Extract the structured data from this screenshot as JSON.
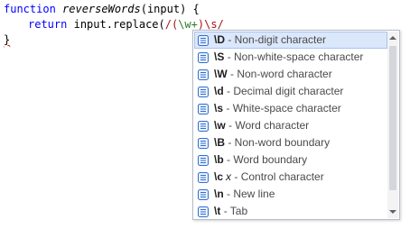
{
  "editor": {
    "line1": {
      "kw_function": "function",
      "name": "reverseWords",
      "params": "(input) {"
    },
    "line2": {
      "kw_return": "return",
      "call": "input.replace(",
      "regex_open": "/(",
      "regex_group": "\\w+",
      "regex_close": ")\\s/"
    },
    "line3": {
      "brace": "}"
    }
  },
  "completion": {
    "items": [
      {
        "token": "\\D",
        "arg": "",
        "description": "- Non-digit character",
        "icon": "snippet-icon",
        "selected": true
      },
      {
        "token": "\\S",
        "arg": "",
        "description": "- Non-white-space character",
        "icon": "snippet-icon",
        "selected": false
      },
      {
        "token": "\\W",
        "arg": "",
        "description": "- Non-word character",
        "icon": "snippet-icon",
        "selected": false
      },
      {
        "token": "\\d",
        "arg": "",
        "description": "- Decimal digit character",
        "icon": "snippet-icon",
        "selected": false
      },
      {
        "token": "\\s",
        "arg": "",
        "description": "- White-space character",
        "icon": "snippet-icon",
        "selected": false
      },
      {
        "token": "\\w",
        "arg": "",
        "description": "- Word character",
        "icon": "snippet-icon",
        "selected": false
      },
      {
        "token": "\\B",
        "arg": "",
        "description": "- Non-word boundary",
        "icon": "snippet-icon",
        "selected": false
      },
      {
        "token": "\\b",
        "arg": "",
        "description": "- Word boundary",
        "icon": "snippet-icon",
        "selected": false
      },
      {
        "token": "\\c",
        "arg": "x",
        "description": "- Control character",
        "icon": "snippet-icon",
        "selected": false
      },
      {
        "token": "\\n",
        "arg": "",
        "description": "- New line",
        "icon": "snippet-icon",
        "selected": false
      },
      {
        "token": "\\t",
        "arg": "",
        "description": "- Tab",
        "icon": "snippet-icon",
        "selected": false
      }
    ]
  },
  "colors": {
    "keyword": "#0000ff",
    "regex": "#a31515",
    "selection_bg": "#dbe7fb",
    "icon_blue": "#2f6fd0"
  }
}
